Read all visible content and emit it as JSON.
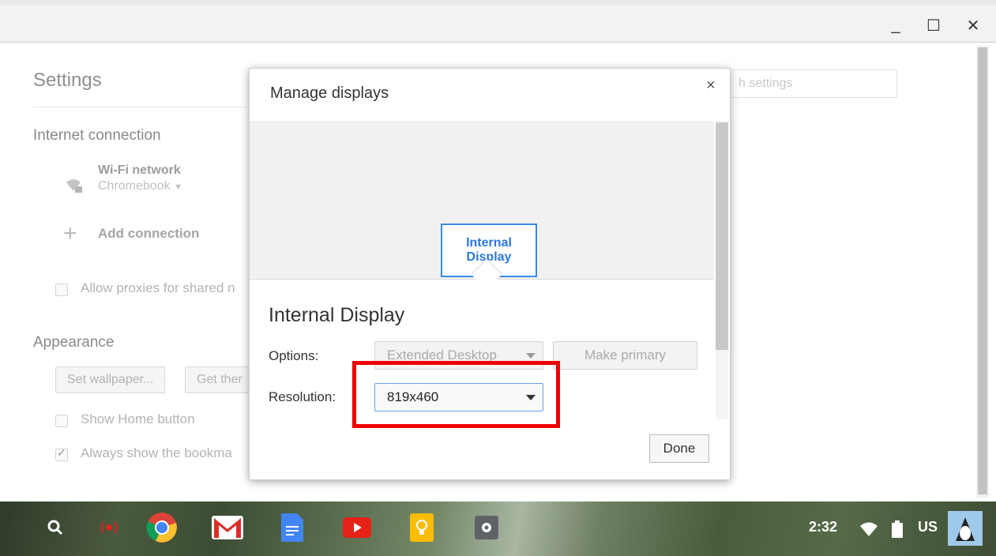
{
  "window": {
    "minimize_glyph": "_",
    "maximize_glyph": "☐",
    "close_glyph": "✕"
  },
  "settings": {
    "title": "Settings",
    "search_placeholder": "h settings",
    "internet_section": "Internet connection",
    "wifi_name": "Wi-Fi network",
    "wifi_network": "Chromebook",
    "add_connection": "Add connection",
    "allow_proxies": "Allow proxies for shared n",
    "appearance_section": "Appearance",
    "set_wallpaper": "Set wallpaper...",
    "get_themes": "Get ther",
    "show_home": "Show Home button",
    "show_bookmarks": "Always show the bookma"
  },
  "dialog": {
    "title": "Manage displays",
    "close_glyph": "×",
    "display_preview_label_line1": "Internal",
    "display_preview_label_line2": "Display",
    "heading": "Internal Display",
    "options_label": "Options:",
    "options_value": "Extended Desktop",
    "make_primary": "Make primary",
    "resolution_label": "Resolution:",
    "resolution_value": "819x460",
    "done": "Done"
  },
  "shelf": {
    "time": "2:32",
    "keyboard": "US",
    "apps": [
      "search-icon",
      "audio-icon",
      "chrome-icon",
      "gmail-icon",
      "docs-icon",
      "youtube-icon",
      "keep-icon",
      "settings-icon"
    ]
  },
  "colors": {
    "highlight": "#ee0000",
    "accent_blue": "#3b8ae6"
  }
}
